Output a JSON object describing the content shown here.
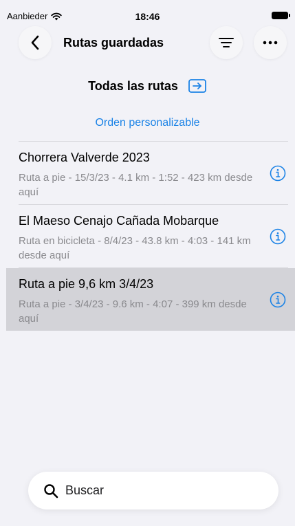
{
  "status_bar": {
    "carrier": "Aanbieder",
    "time": "18:46"
  },
  "nav": {
    "title": "Rutas guardadas"
  },
  "section": {
    "title": "Todas las rutas",
    "sort_label": "Orden personalizable"
  },
  "routes": [
    {
      "title": "Chorrera Valverde 2023",
      "subtitle": "Ruta a pie - 15/3/23 - 4.1 km - 1:52 - 423 km desde aquí",
      "selected": false
    },
    {
      "title": "El Maeso Cenajo Cañada Mobarque",
      "subtitle": "Ruta en bicicleta - 8/4/23 - 43.8 km - 4:03 - 141 km desde aquí",
      "selected": false
    },
    {
      "title": "Ruta a pie 9,6 km 3/4/23",
      "subtitle": "Ruta a pie - 3/4/23 - 9.6 km - 4:07 - 399 km desde aquí",
      "selected": true
    }
  ],
  "search": {
    "placeholder": "Buscar"
  },
  "colors": {
    "accent": "#1a82e6",
    "background": "#f2f2f7",
    "selected_row": "#d3d3d8",
    "secondary_text": "#8a8a8e"
  }
}
